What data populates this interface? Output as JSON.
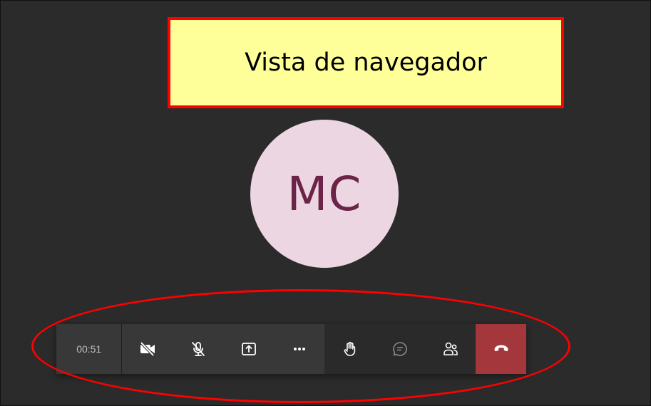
{
  "callout": {
    "text": "Vista de navegador"
  },
  "participant": {
    "initials": "MC"
  },
  "toolbar": {
    "timer": "00:51",
    "buttons": [
      {
        "icon": "camera-off-icon"
      },
      {
        "icon": "mic-off-icon"
      },
      {
        "icon": "share-screen-icon"
      },
      {
        "icon": "more-options-icon"
      },
      {
        "icon": "raise-hand-icon"
      },
      {
        "icon": "chat-icon"
      },
      {
        "icon": "participants-icon"
      },
      {
        "icon": "hang-up-icon"
      }
    ]
  },
  "colors": {
    "stage_bg": "#2b2b2b",
    "toolbar_bg": "#383838",
    "hangup": "#a4373c",
    "avatar_bg": "#ecd6e2",
    "avatar_text": "#6b2447",
    "callout_bg": "#ffff99",
    "annotation": "#ff0000"
  }
}
